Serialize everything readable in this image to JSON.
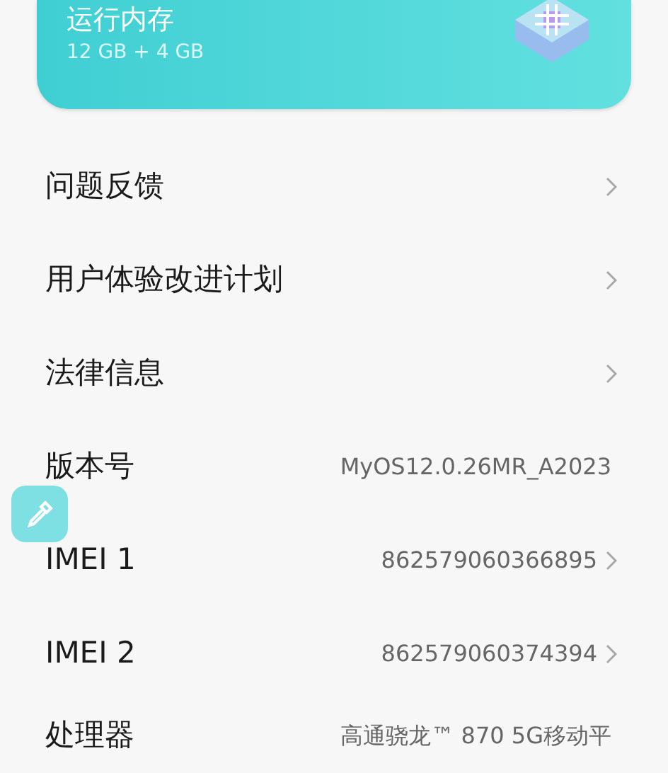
{
  "memory_card": {
    "title": "运行内存",
    "value": "12 GB + 4 GB"
  },
  "rows": [
    {
      "label": "问题反馈",
      "chevron": true
    },
    {
      "label": "用户体验改进计划",
      "chevron": true
    },
    {
      "label": "法律信息",
      "chevron": true
    },
    {
      "label": "版本号",
      "value": "MyOS12.0.26MR_A2023",
      "chevron": false
    },
    {
      "label": "IMEI 1",
      "value": "862579060366895",
      "chevron": true
    },
    {
      "label": "IMEI 2",
      "value": "862579060374394",
      "chevron": true
    },
    {
      "label": "处理器",
      "value": "高通骁龙™ 870 5G移动平",
      "chevron": false
    }
  ]
}
